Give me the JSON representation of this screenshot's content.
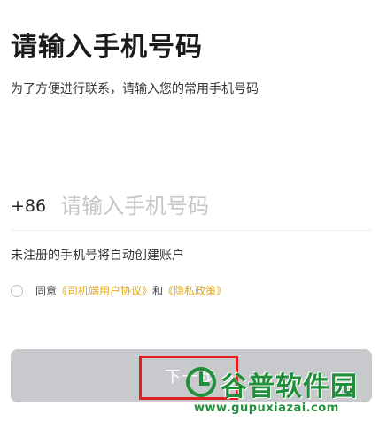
{
  "header": {
    "title": "请输入手机号码",
    "subtitle": "为了方便进行联系，请输入您的常用手机号码"
  },
  "phone": {
    "country_code": "+86",
    "value": "",
    "placeholder": "请输入手机号码"
  },
  "hint": "未注册的手机号将自动创建账户",
  "agreement": {
    "checked": false,
    "prefix": "同意",
    "user_agreement_link": "《司机端用户协议》",
    "and": "和",
    "privacy_link": "《隐私政策》"
  },
  "next_button": {
    "label": "下一步"
  },
  "watermark": {
    "title": "谷普软件园",
    "url": "www.gupuxiazai.com",
    "color": "#1f8f3a"
  },
  "colors": {
    "link": "#e0a61a",
    "button_disabled": "#c8c9cd",
    "highlight": "#e02020"
  }
}
